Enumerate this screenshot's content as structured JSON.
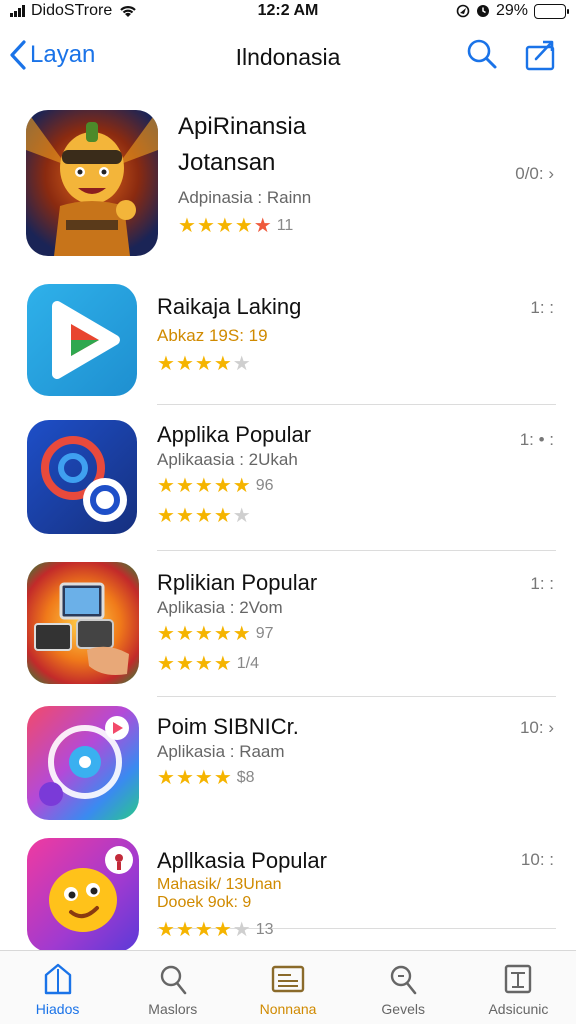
{
  "status_bar": {
    "carrier": "DidoSTrore",
    "time": "12:2 AM",
    "battery_text": "29%",
    "battery_level": 0.9
  },
  "nav": {
    "back_label": "Layan",
    "title": "Ilndonasia",
    "icons": [
      "chevron-left-icon",
      "search-icon",
      "share-icon"
    ]
  },
  "apps": [
    {
      "name_line1": "ApiRinansia",
      "name_line2": "Jotansan",
      "subtitle": "Adpinasia : Rainn",
      "rating_text": "11",
      "right_meta": "0/0: ›"
    },
    {
      "name_line1": "Raikaja Laking",
      "subtitle": "Abkaz 19S: 19",
      "right_meta": "1: :"
    },
    {
      "name_line1": "Applika Popular",
      "subtitle": "Aplikaasia : 2Ukah",
      "rating_text": "96",
      "right_meta": "1: • :"
    },
    {
      "name_line1": "Rplikian Popular",
      "subtitle": "Aplikasia : 2Vom",
      "rating_text": "97",
      "rating_text_2": "1/4",
      "right_meta": "1: :"
    },
    {
      "name_line1": "Poim SIBNICr.",
      "subtitle": "Aplikasia : Raam",
      "rating_text": "$8",
      "right_meta": "10: ›"
    },
    {
      "name_line1": "Apllkasia Popular",
      "subtitle": "Mahasik/ 13Unan",
      "subtitle_2": "Dooek 9ok: 9",
      "rating_text": "13",
      "right_meta": "10: :"
    }
  ],
  "tabs": [
    {
      "label": "Hiados",
      "icon": "home-icon"
    },
    {
      "label": "Maslors",
      "icon": "search-icon"
    },
    {
      "label": "Nonnana",
      "icon": "news-icon"
    },
    {
      "label": "Gevels",
      "icon": "search-icon"
    },
    {
      "label": "Adsicunic",
      "icon": "document-icon"
    }
  ],
  "colors": {
    "accent": "#1a73e8",
    "star": "#f5b400",
    "highlight": "#d08a00"
  }
}
